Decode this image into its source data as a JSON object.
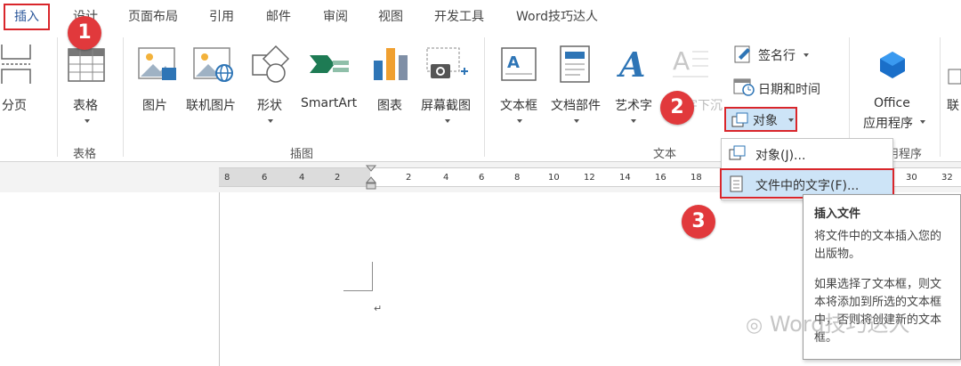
{
  "tabs": [
    {
      "label": "插入",
      "active": true
    },
    {
      "label": "设计"
    },
    {
      "label": "页面布局"
    },
    {
      "label": "引用"
    },
    {
      "label": "邮件"
    },
    {
      "label": "审阅"
    },
    {
      "label": "视图"
    },
    {
      "label": "开发工具"
    },
    {
      "label": "Word技巧达人"
    }
  ],
  "ribbon": {
    "page_break": "分页",
    "table_button": "表格",
    "table_group": "表格",
    "picture": "图片",
    "online_picture": "联机图片",
    "shapes": "形状",
    "smartart": "SmartArt",
    "chart": "图表",
    "screenshot": "屏幕截图",
    "illustrations_group": "插图",
    "textbox": "文本框",
    "quick_parts": "文档部件",
    "wordart": "艺术字",
    "drop_cap": "首字下沉",
    "signature_line": "签名行",
    "date_time": "日期和时间",
    "object": "对象",
    "text_group": "文本",
    "office_apps_line1": "Office",
    "office_apps_line2": "应用程序",
    "apps_group": "应用程序",
    "links_cut": "联"
  },
  "ruler": {
    "ticks": [
      "8",
      "6",
      "4",
      "2",
      "2",
      "4",
      "6",
      "8",
      "10",
      "12",
      "14",
      "16",
      "18",
      "30",
      "32"
    ]
  },
  "dropdown": {
    "items": [
      {
        "label": "对象(J)..."
      },
      {
        "label": "文件中的文字(F)...",
        "highlighted": true
      }
    ]
  },
  "tooltip": {
    "title": "插入文件",
    "line1": "将文件中的文本插入您的出版物。",
    "line2": "如果选择了文本框，则文本将添加到所选的文本框中，否则将创建新的文本框。"
  },
  "badges": [
    "1",
    "2",
    "3"
  ],
  "watermark": "Word技巧达人",
  "colors": {
    "accent": "#2b579a",
    "highlight_border": "#d9262b",
    "badge": "#e1393c",
    "hover": "#cde4f7"
  }
}
